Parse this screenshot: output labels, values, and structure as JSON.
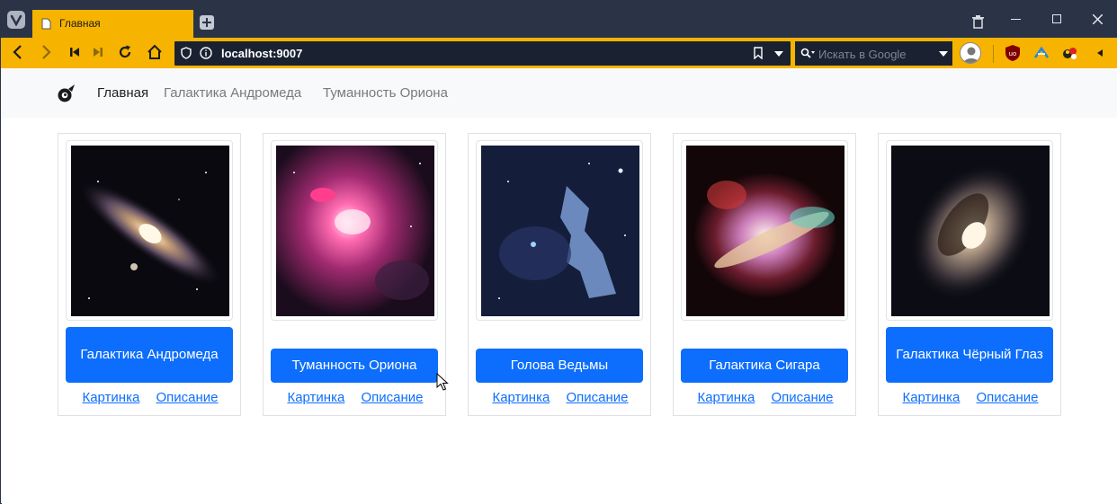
{
  "browser": {
    "tab_title": "Главная",
    "url": "localhost:9007",
    "search_placeholder": "Искать в Google"
  },
  "navbar": {
    "links": [
      {
        "label": "Главная",
        "active": true
      },
      {
        "label": "Галактика Андромеда",
        "active": false
      },
      {
        "label": "Туманность Ориона",
        "active": false
      }
    ]
  },
  "cards": [
    {
      "title": "Галактика Андромеда",
      "image": "andromeda-galaxy",
      "link1": "Картинка",
      "link2": "Описание"
    },
    {
      "title": "Туманность Ориона",
      "image": "orion-nebula",
      "link1": "Картинка",
      "link2": "Описание"
    },
    {
      "title": "Голова Ведьмы",
      "image": "witch-head-nebula",
      "link1": "Картинка",
      "link2": "Описание"
    },
    {
      "title": "Галактика Сигара",
      "image": "cigar-galaxy",
      "link1": "Картинка",
      "link2": "Описание"
    },
    {
      "title": "Галактика Чёрный Глаз",
      "image": "black-eye-galaxy",
      "link1": "Картинка",
      "link2": "Описание"
    }
  ],
  "colors": {
    "toolbar": "#f6b300",
    "tabbar": "#2b3447",
    "button": "#0d6efd",
    "link": "#0d6efd"
  }
}
